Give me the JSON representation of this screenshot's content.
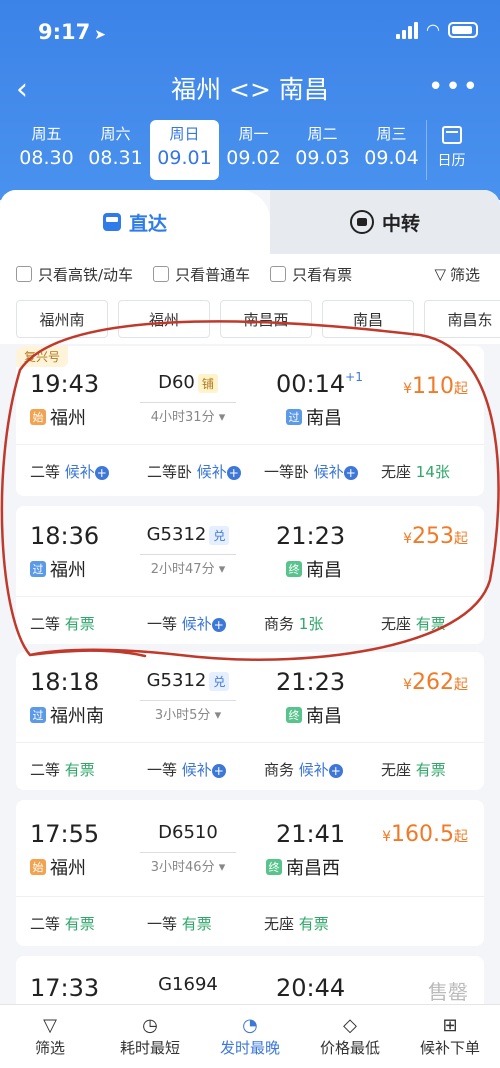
{
  "status": {
    "time": "9:17",
    "location_icon": "location-arrow-icon"
  },
  "nav": {
    "title": "福州 <> 南昌",
    "back_icon": "back-chevron-icon",
    "more_icon": "more-dots-icon"
  },
  "dates": [
    {
      "weekday": "周五",
      "date": "08.30"
    },
    {
      "weekday": "周六",
      "date": "08.31"
    },
    {
      "weekday": "周日",
      "date": "09.01",
      "active": true
    },
    {
      "weekday": "周一",
      "date": "09.02"
    },
    {
      "weekday": "周二",
      "date": "09.03"
    },
    {
      "weekday": "周三",
      "date": "09.04"
    }
  ],
  "calendar_label": "日历",
  "tabs": {
    "direct": "直达",
    "transfer": "中转"
  },
  "filters": {
    "high_speed": "只看高铁/动车",
    "normal": "只看普通车",
    "available": "只看有票",
    "filter": "筛选"
  },
  "stations": [
    "福州南",
    "福州",
    "南昌西",
    "南昌",
    "南昌东"
  ],
  "trains": [
    {
      "tag": "复兴号",
      "dep_time": "19:43",
      "train_no": "D60",
      "badge": "铺",
      "arr_time": "00:14",
      "plus": "+1",
      "duration": "4小时31分",
      "dep_mark": "始",
      "dep_station": "福州",
      "arr_mark": "过",
      "arr_station": "南昌",
      "price": "110",
      "price_suffix": "起",
      "seats": [
        {
          "name": "二等",
          "status": "候补"
        },
        {
          "name": "二等卧",
          "status": "候补"
        },
        {
          "name": "一等卧",
          "status": "候补"
        },
        {
          "name": "无座",
          "status": "14张"
        }
      ]
    },
    {
      "dep_time": "18:36",
      "train_no": "G5312",
      "badge": "兑",
      "arr_time": "21:23",
      "duration": "2小时47分",
      "dep_mark": "过",
      "dep_station": "福州",
      "arr_mark": "终",
      "arr_station": "南昌",
      "price": "253",
      "price_suffix": "起",
      "seats": [
        {
          "name": "二等",
          "status": "有票"
        },
        {
          "name": "一等",
          "status": "候补"
        },
        {
          "name": "商务",
          "status": "1张"
        },
        {
          "name": "无座",
          "status": "有票"
        }
      ]
    },
    {
      "dep_time": "18:18",
      "train_no": "G5312",
      "badge": "兑",
      "arr_time": "21:23",
      "duration": "3小时5分",
      "dep_mark": "过",
      "dep_station": "福州南",
      "arr_mark": "终",
      "arr_station": "南昌",
      "price": "262",
      "price_suffix": "起",
      "seats": [
        {
          "name": "二等",
          "status": "有票"
        },
        {
          "name": "一等",
          "status": "候补"
        },
        {
          "name": "商务",
          "status": "候补"
        },
        {
          "name": "无座",
          "status": "有票"
        }
      ]
    },
    {
      "dep_time": "17:55",
      "train_no": "D6510",
      "arr_time": "21:41",
      "duration": "3小时46分",
      "dep_mark": "始",
      "dep_station": "福州",
      "arr_mark": "终",
      "arr_station": "南昌西",
      "price": "160.5",
      "price_suffix": "起",
      "seats": [
        {
          "name": "二等",
          "status": "有票"
        },
        {
          "name": "一等",
          "status": "有票"
        },
        {
          "name": "无座",
          "status": "有票"
        }
      ]
    },
    {
      "dep_time": "17:33",
      "train_no": "G1694",
      "arr_time": "20:44",
      "sold_out": "售罄"
    }
  ],
  "currency": "¥",
  "bottom_tabs": [
    {
      "label": "筛选",
      "icon": "filter-icon"
    },
    {
      "label": "耗时最短",
      "icon": "timer-icon"
    },
    {
      "label": "发时最晚",
      "icon": "clock-24-icon",
      "active": true
    },
    {
      "label": "价格最低",
      "icon": "price-tag-icon"
    },
    {
      "label": "候补下单",
      "icon": "cart-icon"
    }
  ],
  "colors": {
    "brand": "#3c83e8",
    "price": "#f07a25",
    "available": "#2fa86a",
    "waitlist": "#3d78d8",
    "annotation": "#c0392b"
  }
}
